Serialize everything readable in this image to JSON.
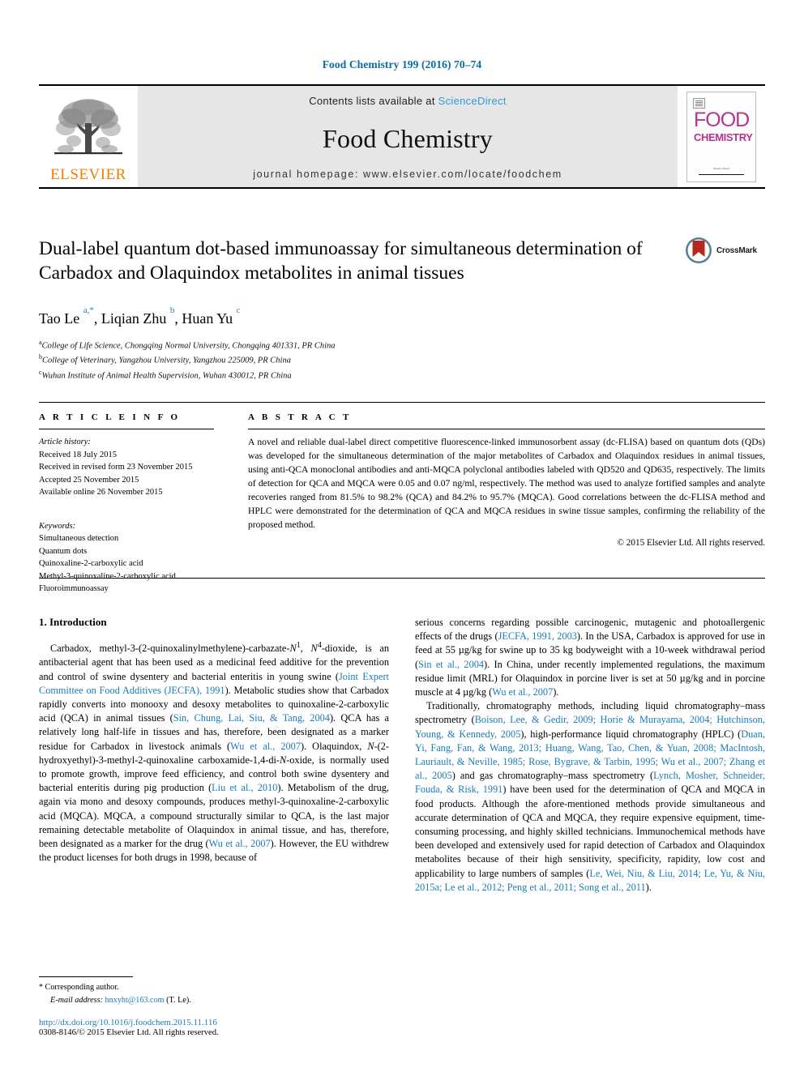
{
  "running_head": "Food Chemistry 199 (2016) 70–74",
  "masthead": {
    "publisher_name": "ELSEVIER",
    "contents_prefix": "Contents lists available at ",
    "contents_link": "ScienceDirect",
    "journal_title": "Food Chemistry",
    "homepage": "journal homepage: www.elsevier.com/locate/foodchem",
    "cover": {
      "line1": "FOOD",
      "line2": "CHEMISTRY",
      "footer": "Science Direct"
    },
    "accent_blue": "#2e9bd6",
    "elsevier_orange": "#F08000",
    "cover_magenta": "#b5348d"
  },
  "article": {
    "title": "Dual-label quantum dot-based immunoassay for simultaneous determination of Carbadox and Olaquindox metabolites in animal tissues",
    "crossmark_label": "CrossMark",
    "authors_html": "Tao Le <sup>a,*</sup>, Liqian Zhu <sup>b</sup>, Huan Yu <sup>c</sup>",
    "affiliations": [
      {
        "marker": "a",
        "text": "College of Life Science, Chongqing Normal University, Chongqing 401331, PR China"
      },
      {
        "marker": "b",
        "text": "College of Veterinary, Yangzhou University, Yangzhou 225009, PR China"
      },
      {
        "marker": "c",
        "text": "Wuhan Institute of Animal Health Supervision, Wuhan 430012, PR China"
      }
    ]
  },
  "article_info": {
    "heading": "A R T I C L E   I N F O",
    "history_label": "Article history:",
    "history": [
      "Received 18 July 2015",
      "Received in revised form 23 November 2015",
      "Accepted 25 November 2015",
      "Available online 26 November 2015"
    ],
    "keywords_label": "Keywords:",
    "keywords": [
      "Simultaneous detection",
      "Quantum dots",
      "Quinoxaline-2-carboxylic acid",
      "Methyl-3-quinoxaline-2-carboxylic acid",
      "Fluoroimmunoassay"
    ]
  },
  "abstract": {
    "heading": "A B S T R A C T",
    "text": "A novel and reliable dual-label direct competitive fluorescence-linked immunosorbent assay (dc-FLISA) based on quantum dots (QDs) was developed for the simultaneous determination of the major metabolites of Carbadox and Olaquindox residues in animal tissues, using anti-QCA monoclonal antibodies and anti-MQCA polyclonal antibodies labeled with QD520 and QD635, respectively. The limits of detection for QCA and MQCA were 0.05 and 0.07 ng/ml, respectively. The method was used to analyze fortified samples and analyte recoveries ranged from 81.5% to 98.2% (QCA) and 84.2% to 95.7% (MQCA). Good correlations between the dc-FLISA method and HPLC were demonstrated for the determination of QCA and MQCA residues in swine tissue samples, confirming the reliability of the proposed method.",
    "copyright": "© 2015 Elsevier Ltd. All rights reserved."
  },
  "body": {
    "section_heading": "1. Introduction",
    "left_paragraph_html": "Carbadox, methyl-3-(2-quinoxalinylmethylene)-carbazate-<i>N</i><sup>1</sup>, <i>N</i><sup>4</sup>-dioxide, is an antibacterial agent that has been used as a medicinal feed additive for the prevention and control of swine dysentery and bacterial enteritis in young swine (<span class=\"ref\">Joint Expert Committee on Food Additives (JECFA), 1991</span>). Metabolic studies show that Carbadox rapidly converts into monooxy and desoxy metabolites to quinoxaline-2-carboxylic acid (QCA) in animal tissues (<span class=\"ref\">Sin, Chung, Lai, Siu, &amp; Tang, 2004</span>). QCA has a relatively long half-life in tissues and has, therefore, been designated as a marker residue for Carbadox in livestock animals (<span class=\"ref\">Wu et al., 2007</span>). Olaquindox, <i>N</i>-(2-hydroxyethyl)-3-methyl-2-quinoxaline carboxamide-1,4-di-<i>N</i>-oxide, is normally used to promote growth, improve feed efficiency, and control both swine dysentery and bacterial enteritis during pig production (<span class=\"ref\">Liu et al., 2010</span>). Metabolism of the drug, again via mono and desoxy compounds, produces methyl-3-quinoxaline-2-carboxylic acid (MQCA). MQCA, a compound structurally similar to QCA, is the last major remaining detectable metabolite of Olaquindox in animal tissue, and has, therefore, been designated as a marker for the drug (<span class=\"ref\">Wu et al., 2007</span>). However, the EU withdrew the product licenses for both drugs in 1998, because of",
    "right_paragraph1_html": "serious concerns regarding possible carcinogenic, mutagenic and photoallergenic effects of the drugs (<span class=\"ref\">JECFA, 1991, 2003</span>). In the USA, Carbadox is approved for use in feed at 55 µg/kg for swine up to 35 kg bodyweight with a 10-week withdrawal period (<span class=\"ref\">Sin et al., 2004</span>). In China, under recently implemented regulations, the maximum residue limit (MRL) for Olaquindox in porcine liver is set at 50 µg/kg and in porcine muscle at 4 µg/kg (<span class=\"ref\">Wu et al., 2007</span>).",
    "right_paragraph2_html": "Traditionally, chromatography methods, including liquid chromatography–mass spectrometry (<span class=\"ref\">Boison, Lee, &amp; Gedir, 2009; Horie &amp; Murayama, 2004; Hutchinson, Young, &amp; Kennedy, 2005</span>), high-performance liquid chromatography (HPLC) (<span class=\"ref\">Duan, Yi, Fang, Fan, &amp; Wang, 2013; Huang, Wang, Tao, Chen, &amp; Yuan, 2008; MacIntosh, Lauriault, &amp; Neville, 1985; Rose, Bygrave, &amp; Tarbin, 1995; Wu et al., 2007; Zhang et al., 2005</span>) and gas chromatography–mass spectrometry (<span class=\"ref\">Lynch, Mosher, Schneider, Fouda, &amp; Risk, 1991</span>) have been used for the determination of QCA and MQCA in food products. Although the afore-mentioned methods provide simultaneous and accurate determination of QCA and MQCA, they require expensive equipment, time-consuming processing, and highly skilled technicians. Immunochemical methods have been developed and extensively used for rapid detection of Carbadox and Olaquindox metabolites because of their high sensitivity, specificity, rapidity, low cost and applicability to large numbers of samples (<span class=\"ref\">Le, Wei, Niu, &amp; Liu, 2014; Le, Yu, &amp; Niu, 2015a; Le et al., 2012; Peng et al., 2011; Song et al., 2011</span>)."
  },
  "footer": {
    "corresponding_marker": "*",
    "corresponding_text": "Corresponding author.",
    "email_label": "E-mail address:",
    "email": "hnxyht@163.com",
    "email_suffix": "(T. Le).",
    "doi": "http://dx.doi.org/10.1016/j.foodchem.2015.11.116",
    "issn_line": "0308-8146/© 2015 Elsevier Ltd. All rights reserved."
  }
}
